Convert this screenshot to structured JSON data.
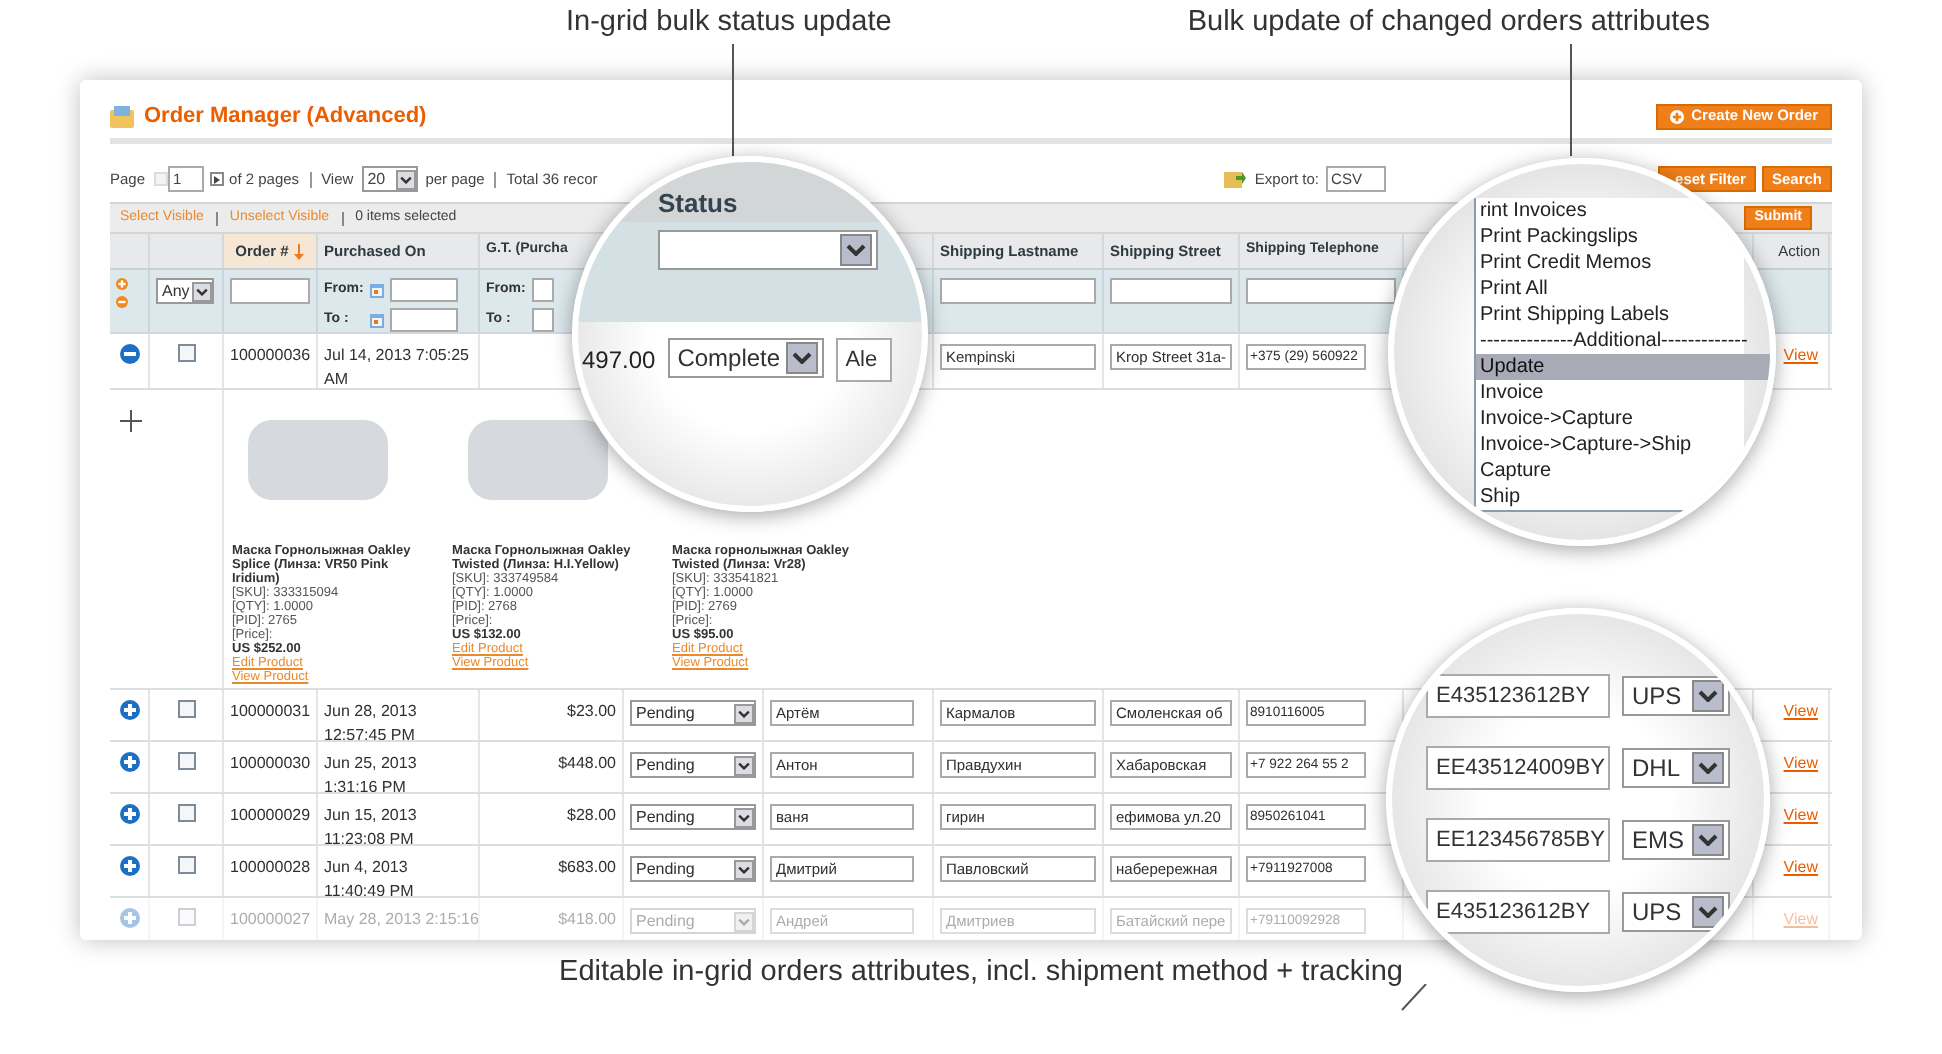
{
  "callouts": {
    "status_update": "In-grid bulk status update",
    "bulk_update": "Bulk update of changed orders attributes",
    "editable": "Editable in-grid orders attributes, incl. shipment method + tracking"
  },
  "header": {
    "title": "Order Manager (Advanced)",
    "create_button": "Create New Order"
  },
  "pager": {
    "page_label": "Page",
    "page": "1",
    "of_pages": "of 2 pages",
    "view_label": "View",
    "per_page": "20",
    "per_page_label": "per page",
    "total": "Total 36 recor",
    "export_label": "Export to:",
    "export_format": "CSV",
    "reset_button": "eset Filter",
    "search_button": "Search"
  },
  "massaction": {
    "select_visible": "Select Visible",
    "unselect_visible": "Unselect Visible",
    "selected_count": "0 items selected",
    "submit_button": "Submit"
  },
  "grid": {
    "columns": [
      {
        "label": "Order #",
        "sorted": true
      },
      {
        "label": "Purchased On",
        "sorted": false
      },
      {
        "label": "G.T. (Purcha",
        "sorted": false
      },
      {
        "label": "Shipping Lastname",
        "sorted": false
      },
      {
        "label": "Shipping Street",
        "sorted": false
      },
      {
        "label": "Shipping Telephone",
        "sorted": false
      },
      {
        "label": "Action",
        "sorted": false
      }
    ],
    "filter": {
      "checkbox_filter": "Any",
      "ranges": [
        {
          "from_label": "From:",
          "to_label": "To :"
        },
        {
          "from_label": "From:",
          "to_label": "To :"
        }
      ]
    },
    "rows": [
      {
        "expanded": true,
        "checked": false,
        "faded": false,
        "order": "100000036",
        "purchased": "Jul 14, 2013 7:05:25 AM",
        "lastname": "Kempinski",
        "street": "Krop Street 31a-",
        "phone": "+375 (29) 560922",
        "action": "View"
      },
      {
        "expanded": false,
        "checked": false,
        "faded": false,
        "order": "100000031",
        "purchased": "Jun 28, 2013 12:57:45 PM",
        "total": "$23.00",
        "status": "Pending",
        "firstname": "Артём",
        "lastname": "Кармалов",
        "street": "Смоленская об",
        "phone": "8910116005",
        "action": "View"
      },
      {
        "expanded": false,
        "checked": false,
        "faded": false,
        "order": "100000030",
        "purchased": "Jun 25, 2013 1:31:16 PM",
        "total": "$448.00",
        "status": "Pending",
        "firstname": "Антон",
        "lastname": "Правдухин",
        "street": "Хабаровская",
        "phone": "+7 922 264 55 2",
        "action": "View"
      },
      {
        "expanded": false,
        "checked": false,
        "faded": false,
        "order": "100000029",
        "purchased": "Jun 15, 2013 11:23:08 PM",
        "total": "$28.00",
        "status": "Pending",
        "firstname": "ваня",
        "lastname": "гирин",
        "street": "ефимова ул.20",
        "phone": "8950261041",
        "action": "View"
      },
      {
        "expanded": false,
        "checked": false,
        "faded": false,
        "order": "100000028",
        "purchased": "Jun 4, 2013 11:40:49 PM",
        "total": "$683.00",
        "status": "Pending",
        "firstname": "Дмитрий",
        "lastname": "Павловский",
        "street": "наберережная",
        "phone": "+7911927008",
        "action": "View"
      },
      {
        "expanded": false,
        "checked": false,
        "faded": true,
        "order": "100000027",
        "purchased": "May 28, 2013 2:15:16",
        "total": "$418.00",
        "status": "Pending",
        "firstname": "Андрей",
        "lastname": "Дмитриев",
        "street": "Батайский пере",
        "phone": "+79110092928",
        "action": "View"
      }
    ],
    "products": [
      {
        "name": "Маска Горнолыжная Oakley Splice (Линза: VR50 Pink Iridium)",
        "sku": "[SKU]: 333315094",
        "qty": "[QTY]: 1.0000",
        "pid": "[PID]: 2765",
        "price_label": "[Price]:",
        "price": "US $252.00",
        "edit_link": "Edit Product",
        "view_link": "View Product"
      },
      {
        "name": "Маска Горнолыжная Oakley Twisted (Линза: H.I.Yellow)",
        "sku": "[SKU]: 333749584",
        "qty": "[QTY]: 1.0000",
        "pid": "[PID]: 2768",
        "price_label": "[Price]:",
        "price": "US $132.00",
        "edit_link": "Edit Product",
        "view_link": "View Product"
      },
      {
        "name": "Маска горнолыжная Oakley Twisted (Линза: Vr28)",
        "sku": "[SKU]: 333541821",
        "qty": "[QTY]: 1.0000",
        "pid": "[PID]: 2769",
        "price_label": "[Price]:",
        "price": "US $95.00",
        "edit_link": "Edit Product",
        "view_link": "View Product"
      }
    ]
  },
  "magnifiers": {
    "status": {
      "header": "Status",
      "total": "497.00",
      "status": "Complete",
      "firstname": "Ale"
    },
    "actions": {
      "items": [
        {
          "label": "rint Invoices",
          "selected": false
        },
        {
          "label": "Print Packingslips",
          "selected": false
        },
        {
          "label": "Print Credit Memos",
          "selected": false
        },
        {
          "label": "Print All",
          "selected": false
        },
        {
          "label": "Print Shipping Labels",
          "selected": false
        },
        {
          "label": "--------------Additional-------------",
          "selected": false
        },
        {
          "label": "Update",
          "selected": true
        },
        {
          "label": "Invoice",
          "selected": false
        },
        {
          "label": "Invoice->Capture",
          "selected": false
        },
        {
          "label": "Invoice->Capture->Ship",
          "selected": false
        },
        {
          "label": "Capture",
          "selected": false
        },
        {
          "label": "Ship",
          "selected": false
        }
      ]
    },
    "tracking": {
      "rows": [
        {
          "tracking": "E435123612BY",
          "carrier": "UPS"
        },
        {
          "tracking": "EE435124009BY",
          "carrier": "DHL"
        },
        {
          "tracking": "EE123456785BY",
          "carrier": "EMS"
        },
        {
          "tracking": "E435123612BY",
          "carrier": "UPS"
        }
      ]
    }
  }
}
